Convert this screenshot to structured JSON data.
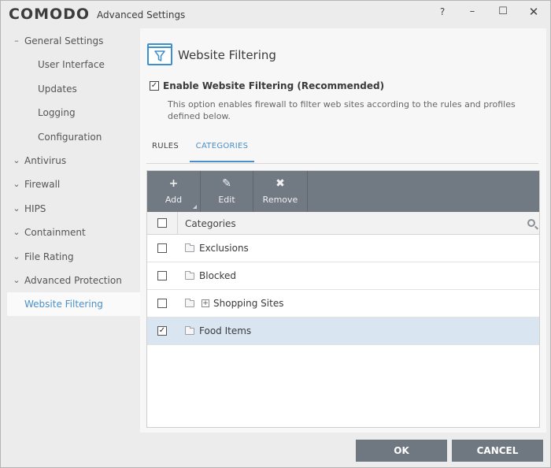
{
  "window": {
    "brand": "COMODO",
    "title": "Advanced Settings",
    "help": "?",
    "minimize": "–",
    "maximize": "☐",
    "close": "✕"
  },
  "sidebar": {
    "items": [
      {
        "label": "General Settings",
        "chevron": "–"
      },
      {
        "label": "User Interface"
      },
      {
        "label": "Updates"
      },
      {
        "label": "Logging"
      },
      {
        "label": "Configuration"
      },
      {
        "label": "Antivirus",
        "chevron": "⌄"
      },
      {
        "label": "Firewall",
        "chevron": "⌄"
      },
      {
        "label": "HIPS",
        "chevron": "⌄"
      },
      {
        "label": "Containment",
        "chevron": "⌄"
      },
      {
        "label": "File Rating",
        "chevron": "⌄"
      },
      {
        "label": "Advanced Protection",
        "chevron": "⌄"
      },
      {
        "label": "Website Filtering",
        "active": true
      }
    ]
  },
  "main": {
    "title": "Website Filtering",
    "enable": {
      "label": "Enable Website Filtering (Recommended)",
      "checked": "✓",
      "description": "This option enables firewall to filter web sites according to the rules and profiles defined below."
    },
    "tabs": [
      {
        "label": "RULES"
      },
      {
        "label": "CATEGORIES",
        "active": true
      }
    ],
    "toolbar": {
      "add": {
        "icon": "+",
        "label": "Add"
      },
      "edit": {
        "icon": "✎",
        "label": "Edit"
      },
      "remove": {
        "icon": "✖",
        "label": "Remove"
      }
    },
    "table": {
      "header": "Categories",
      "rows": [
        {
          "name": "Exclusions",
          "checked": ""
        },
        {
          "name": "Blocked",
          "checked": ""
        },
        {
          "name": "Shopping Sites",
          "checked": "",
          "expand": "+"
        },
        {
          "name": "Food Items",
          "checked": "✓",
          "selected": true
        }
      ]
    }
  },
  "footer": {
    "ok": "OK",
    "cancel": "CANCEL"
  }
}
